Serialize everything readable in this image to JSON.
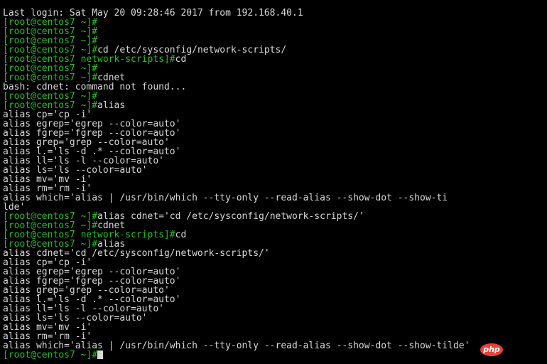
{
  "colors": {
    "background": "#000000",
    "text": "#d9d9d9",
    "prompt": "#1fc21f",
    "badge": "#e8403a"
  },
  "terminal": {
    "lines": [
      {
        "type": "output",
        "text": "Last login: Sat May 20 09:28:46 2017 from 192.168.40.1"
      },
      {
        "type": "prompt",
        "user_host": "[root@centos7 ",
        "dir": "~",
        "close": "]#",
        "cmd": ""
      },
      {
        "type": "prompt",
        "user_host": "[root@centos7 ",
        "dir": "~",
        "close": "]#",
        "cmd": ""
      },
      {
        "type": "prompt",
        "user_host": "[root@centos7 ",
        "dir": "~",
        "close": "]#",
        "cmd": ""
      },
      {
        "type": "prompt",
        "user_host": "[root@centos7 ",
        "dir": "~",
        "close": "]#",
        "cmd": "cd /etc/sysconfig/network-scripts/"
      },
      {
        "type": "prompt",
        "user_host": "[root@centos7 ",
        "dir": "network-scripts",
        "close": "]#",
        "cmd": "cd"
      },
      {
        "type": "prompt",
        "user_host": "[root@centos7 ",
        "dir": "~",
        "close": "]#",
        "cmd": ""
      },
      {
        "type": "prompt",
        "user_host": "[root@centos7 ",
        "dir": "~",
        "close": "]#",
        "cmd": "cdnet"
      },
      {
        "type": "output",
        "text": "bash: cdnet: command not found..."
      },
      {
        "type": "prompt",
        "user_host": "[root@centos7 ",
        "dir": "~",
        "close": "]#",
        "cmd": ""
      },
      {
        "type": "prompt",
        "user_host": "[root@centos7 ",
        "dir": "~",
        "close": "]#",
        "cmd": "alias"
      },
      {
        "type": "output",
        "text": "alias cp='cp -i'"
      },
      {
        "type": "output",
        "text": "alias egrep='egrep --color=auto'"
      },
      {
        "type": "output",
        "text": "alias fgrep='fgrep --color=auto'"
      },
      {
        "type": "output",
        "text": "alias grep='grep --color=auto'"
      },
      {
        "type": "output",
        "text": "alias l.='ls -d .* --color=auto'"
      },
      {
        "type": "output",
        "text": "alias ll='ls -l --color=auto'"
      },
      {
        "type": "output",
        "text": "alias ls='ls --color=auto'"
      },
      {
        "type": "output",
        "text": "alias mv='mv -i'"
      },
      {
        "type": "output",
        "text": "alias rm='rm -i'"
      },
      {
        "type": "output",
        "text": "alias which='alias | /usr/bin/which --tty-only --read-alias --show-dot --show-ti"
      },
      {
        "type": "output",
        "text": "lde'"
      },
      {
        "type": "prompt",
        "user_host": "[root@centos7 ",
        "dir": "~",
        "close": "]#",
        "cmd": "alias cdnet='cd /etc/sysconfig/network-scripts/'"
      },
      {
        "type": "prompt",
        "user_host": "[root@centos7 ",
        "dir": "~",
        "close": "]#",
        "cmd": "cdnet"
      },
      {
        "type": "prompt",
        "user_host": "[root@centos7 ",
        "dir": "network-scripts",
        "close": "]#",
        "cmd": "cd"
      },
      {
        "type": "prompt",
        "user_host": "[root@centos7 ",
        "dir": "~",
        "close": "]#",
        "cmd": "alias"
      },
      {
        "type": "output",
        "text": "alias cdnet='cd /etc/sysconfig/network-scripts/'"
      },
      {
        "type": "output",
        "text": "alias cp='cp -i'"
      },
      {
        "type": "output",
        "text": "alias egrep='egrep --color=auto'"
      },
      {
        "type": "output",
        "text": "alias fgrep='fgrep --color=auto'"
      },
      {
        "type": "output",
        "text": "alias grep='grep --color=auto'"
      },
      {
        "type": "output",
        "text": "alias l.='ls -d .* --color=auto'"
      },
      {
        "type": "output",
        "text": "alias ll='ls -l --color=auto'"
      },
      {
        "type": "output",
        "text": "alias ls='ls --color=auto'"
      },
      {
        "type": "output",
        "text": "alias mv='mv -i'"
      },
      {
        "type": "output",
        "text": "alias rm='rm -i'"
      },
      {
        "type": "output",
        "text": "alias which='alias | /usr/bin/which --tty-only --read-alias --show-dot --show-tilde'"
      },
      {
        "type": "prompt",
        "user_host": "[root@centos7 ",
        "dir": "~",
        "close": "]#",
        "cmd": "",
        "cursor": true
      }
    ]
  },
  "watermark": {
    "label": "php"
  }
}
